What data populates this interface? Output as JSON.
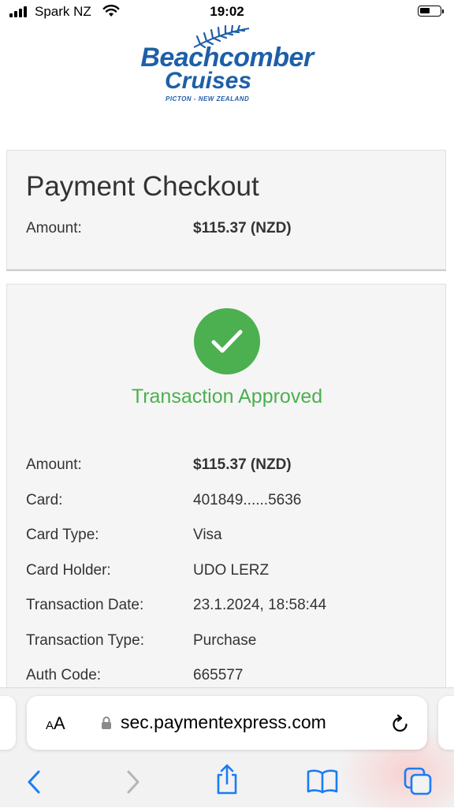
{
  "status_bar": {
    "carrier": "Spark NZ",
    "time": "19:02"
  },
  "logo": {
    "line1": "Beachcomber",
    "line2": "Cruises",
    "tagline": "PICTON - NEW ZEALAND"
  },
  "header": {
    "title": "Payment Checkout",
    "amount_label": "Amount:",
    "amount_value": "$115.37 (NZD)"
  },
  "result": {
    "status": "Transaction Approved",
    "status_color": "#4caf50",
    "details": [
      {
        "label": "Amount:",
        "value": "$115.37 (NZD)"
      },
      {
        "label": "Card:",
        "value": "401849......5636"
      },
      {
        "label": "Card Type:",
        "value": "Visa"
      },
      {
        "label": "Card Holder:",
        "value": "UDO LERZ"
      },
      {
        "label": "Transaction Date:",
        "value": "23.1.2024, 18:58:44"
      },
      {
        "label": "Transaction Type:",
        "value": "Purchase"
      },
      {
        "label": "Auth Code:",
        "value": "665577"
      }
    ]
  },
  "browser": {
    "text_size_label": "AA",
    "url": "sec.paymentexpress.com",
    "toolbar_icons": [
      "back-icon",
      "forward-icon",
      "share-icon",
      "bookmarks-icon",
      "tabs-icon"
    ]
  },
  "colors": {
    "brand_blue": "#1e5fa8",
    "success_green": "#4caf50",
    "ios_blue": "#1a7cf5"
  }
}
